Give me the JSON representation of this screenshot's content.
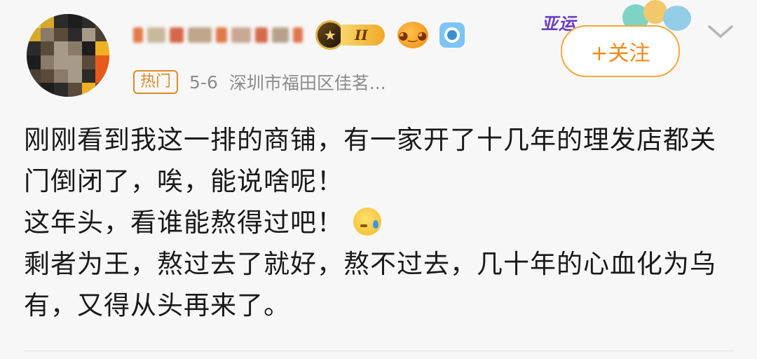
{
  "post": {
    "author_name": "",
    "level_label": "II",
    "hot_tag": "热门",
    "date": "5-6",
    "location": "深圳市福田区佳茗...",
    "follow_label": "+关注",
    "promo_text": "亚运",
    "content_lines": [
      "刚刚看到我这一排的商铺，有一家开了十几年的理发店都关门倒闭了，唉，能说啥呢！",
      "这年头，看谁能熬得过吧！",
      "剩者为王，熬过去了就好，熬不过去，几十年的心血化为乌有，又得从头再来了。"
    ]
  },
  "icons": {
    "avatar": "user-avatar-pixelated",
    "crown": "crown-badge-icon",
    "fish": "pufferfish-badge-icon",
    "camera": "camera-badge-icon",
    "chevron": "chevron-down-icon",
    "emoji": "sweat-face-emoji-icon"
  },
  "colors": {
    "accent": "#f08a1a",
    "hot_tag": "#d98c2c",
    "meta": "#8c8c8c",
    "promo": "#6a3fc1"
  }
}
